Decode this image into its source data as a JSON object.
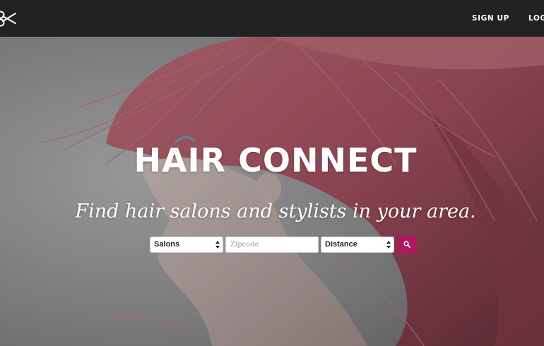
{
  "navbar": {
    "logo_icon": "scissors-icon",
    "links": [
      {
        "label": "SIGN UP"
      },
      {
        "label": "LOG IN"
      }
    ]
  },
  "hero": {
    "title": "HAIR CONNECT",
    "tagline": "Find hair salons and stylists in your area."
  },
  "search": {
    "category_select": {
      "value": "Salons"
    },
    "zipcode_input": {
      "value": "",
      "placeholder": "Zipcode"
    },
    "distance_select": {
      "value": "Distance"
    },
    "button_icon": "search-icon"
  },
  "colors": {
    "navbar_bg": "#222222",
    "accent": "#b0175e",
    "hero_text": "#ffffff"
  }
}
